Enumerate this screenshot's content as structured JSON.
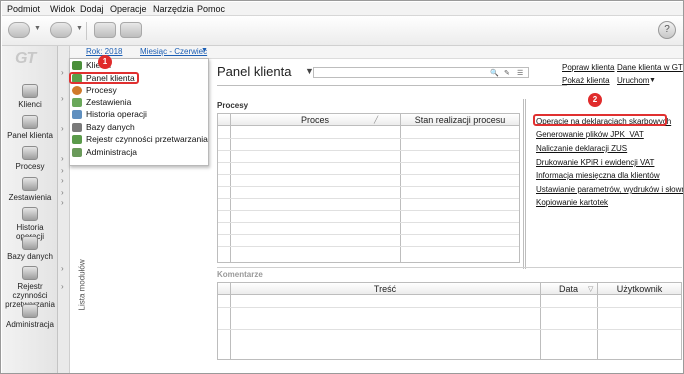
{
  "menu": [
    "Podmiot",
    "Widok",
    "Dodaj",
    "Operacje",
    "Narzędzia",
    "Pomoc"
  ],
  "logo": "GT",
  "sidebar": {
    "items": [
      {
        "label": "Klienci"
      },
      {
        "label": "Panel klienta"
      },
      {
        "label": "Procesy"
      },
      {
        "label": "Zestawienia"
      },
      {
        "label": "Historia operacji"
      },
      {
        "label": "Bazy danych"
      },
      {
        "label": "Rejestr czynności przetwarzania"
      },
      {
        "label": "Administracja"
      }
    ]
  },
  "strip_label": "Lista modułów",
  "period": {
    "year": "Rok: 2018",
    "month": "Miesiąc - Czerwiec"
  },
  "tree": {
    "items": [
      {
        "label": "Klienci",
        "color": "#4a8f3a"
      },
      {
        "label": "Panel klienta",
        "color": "#5aa04a"
      },
      {
        "label": "Procesy",
        "color": "#d07a2a"
      },
      {
        "label": "Zestawienia",
        "color": "#6aa85a"
      },
      {
        "label": "Historia operacji",
        "color": "#5f8fbf"
      },
      {
        "label": "Bazy danych",
        "color": "#7a7a7a"
      },
      {
        "label": "Rejestr czynności przetwarzania",
        "color": "#5a9a4a"
      },
      {
        "label": "Administracja",
        "color": "#6a9a5a"
      }
    ]
  },
  "badges": {
    "first": "1",
    "second": "2"
  },
  "main": {
    "title": "Panel klienta",
    "links": {
      "popraw": "Popraw klienta",
      "dane": "Dane klienta w GT",
      "pokaz": "Pokaż klienta",
      "uruchom": "Uruchom"
    },
    "procesy_label": "Procesy",
    "komentarze_label": "Komentarze",
    "processes_table": {
      "columns": [
        "Proces",
        "Stan realizacji procesu"
      ]
    },
    "comments_table": {
      "columns": [
        "Treść",
        "Data",
        "Użytkownik"
      ]
    },
    "right_links": [
      "Operacje na deklaracjach skarbowych",
      "Generowanie plików JPK_VAT",
      "Naliczanie deklaracji ZUS",
      "Drukowanie KPiR i ewidencji VAT",
      "Informacja miesięczna dla klientów",
      "Ustawianie parametrów, wydruków i słowników",
      "Kopiowanie kartotek"
    ]
  }
}
